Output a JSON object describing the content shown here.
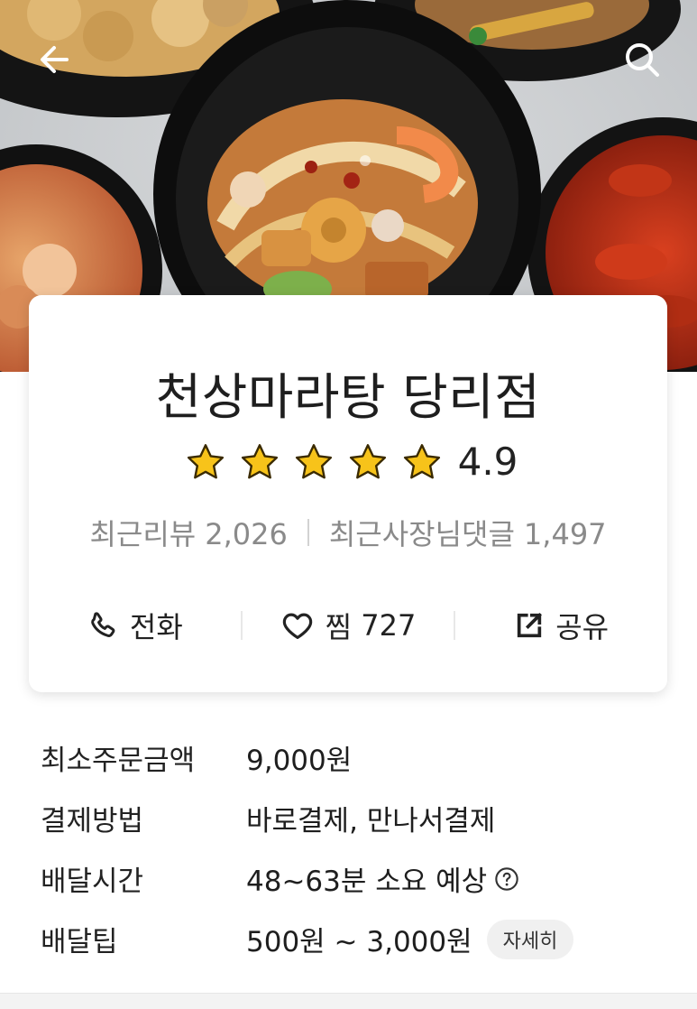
{
  "store": {
    "name": "천상마라탕 당리점",
    "rating": "4.9",
    "stars_filled": 5,
    "review_label": "최근리뷰",
    "review_count": "2,026",
    "owner_reply_label": "최근사장님댓글",
    "owner_reply_count": "1,497"
  },
  "actions": {
    "call_label": "전화",
    "like_label": "찜",
    "like_count": "727",
    "share_label": "공유"
  },
  "details": [
    {
      "label": "최소주문금액",
      "value": "9,000원"
    },
    {
      "label": "결제방법",
      "value": "바로결제, 만나서결제"
    },
    {
      "label": "배달시간",
      "value": "48~63분 소요 예상"
    },
    {
      "label": "배달팁",
      "value": "500원 ~ 3,000원"
    }
  ],
  "delivery_tip_more_label": "자세히",
  "colors": {
    "star": "#f7c31a",
    "text": "#222222",
    "muted": "#8a8a8a"
  },
  "icons": [
    "back-arrow-icon",
    "search-icon",
    "star-icon",
    "phone-icon",
    "heart-icon",
    "share-icon",
    "question-icon"
  ]
}
